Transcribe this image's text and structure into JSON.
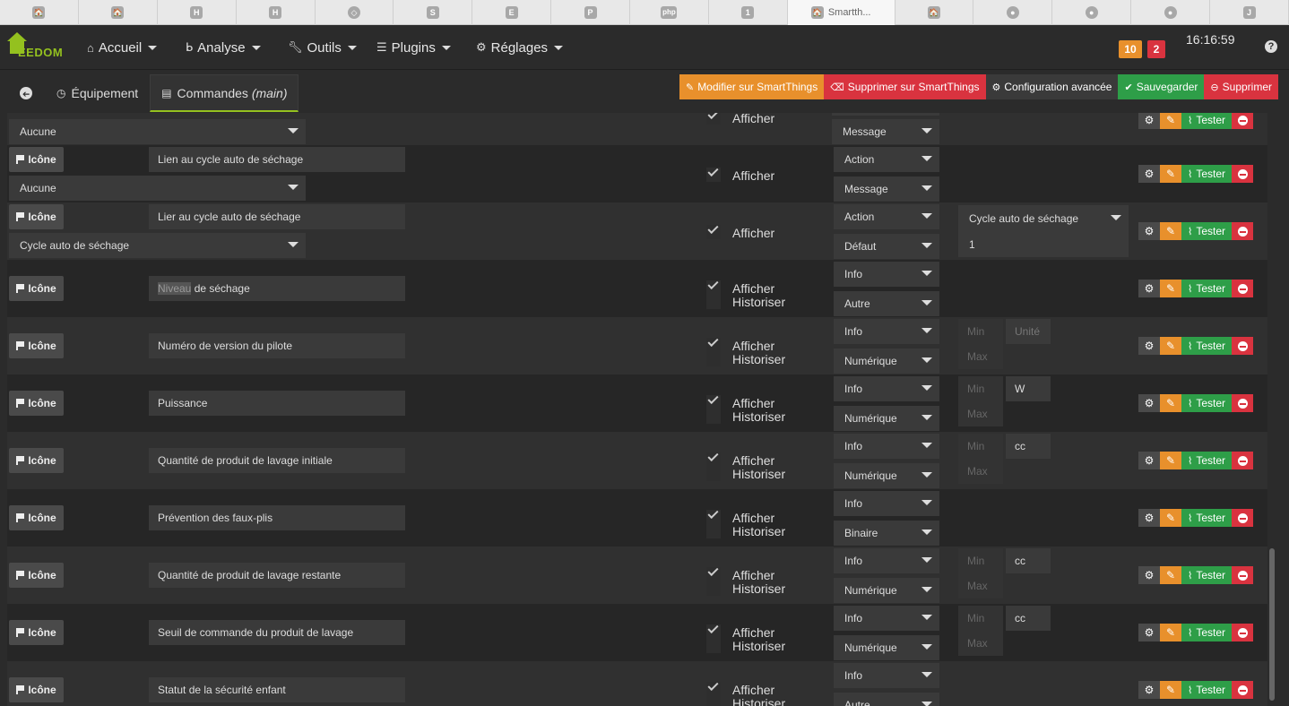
{
  "browser_tabs": [
    {
      "icon": "🏠",
      "label": ""
    },
    {
      "icon": "🏠",
      "label": ""
    },
    {
      "icon": "H",
      "label": ""
    },
    {
      "icon": "H",
      "label": ""
    },
    {
      "icon": "◇",
      "label": ""
    },
    {
      "icon": "S",
      "label": ""
    },
    {
      "icon": "E",
      "label": ""
    },
    {
      "icon": "P",
      "label": ""
    },
    {
      "icon": "php",
      "label": ""
    },
    {
      "icon": "1",
      "label": ""
    },
    {
      "icon": "🏠",
      "label": "Smartth..."
    },
    {
      "icon": "🏠",
      "label": ""
    },
    {
      "icon": "●",
      "label": ""
    },
    {
      "icon": "●",
      "label": ""
    },
    {
      "icon": "●",
      "label": ""
    },
    {
      "icon": "J",
      "label": ""
    }
  ],
  "nav": {
    "logo": "EEDOM",
    "menus": [
      {
        "label": "Accueil"
      },
      {
        "label": "Analyse"
      },
      {
        "label": "Outils"
      },
      {
        "label": "Plugins"
      },
      {
        "label": "Réglages"
      }
    ],
    "badge_warning": "10",
    "badge_danger": "2",
    "clock": "16:16:59",
    "help": "?"
  },
  "subtabs": {
    "back": "➔",
    "equipment": "Équipement",
    "commands": "Commandes",
    "commands_suffix": "(main)"
  },
  "actions": {
    "modify": "Modifier sur SmartThings",
    "delete_st": "Supprimer sur SmartThings",
    "advanced": "Configuration avancée",
    "save": "Sauvegarder",
    "delete": "Supprimer"
  },
  "commands": {
    "icon_label": "Icône",
    "afficher": "Afficher",
    "historiser": "Historiser",
    "tester": "Tester",
    "min_placeholder": "Min",
    "max_placeholder": "Max",
    "unit_placeholder": "Unité",
    "partial_row": {
      "value_select": "Aucune",
      "type": "",
      "subtype": "Message"
    },
    "rows": [
      {
        "name": "Lien au cycle auto de séchage",
        "value_select": "Aucune",
        "type": "Action",
        "subtype": "Message",
        "historiser": false
      },
      {
        "name": "Lier au cycle auto de séchage",
        "value_select": "Cycle auto de séchage",
        "type": "Action",
        "subtype": "Défaut",
        "historiser": false,
        "cycle_select": "Cycle auto de séchage",
        "cycle_value": "1"
      },
      {
        "name_highlight": "Niveau",
        "name": " de séchage",
        "type": "Info",
        "subtype": "Autre",
        "historiser": true
      },
      {
        "name": "Numéro de version du pilote",
        "type": "Info",
        "subtype": "Numérique",
        "historiser": true,
        "unit": ""
      },
      {
        "name": "Puissance",
        "type": "Info",
        "subtype": "Numérique",
        "historiser": true,
        "unit": "W"
      },
      {
        "name": "Quantité de produit de lavage initiale",
        "type": "Info",
        "subtype": "Numérique",
        "historiser": true,
        "unit": "cc"
      },
      {
        "name": "Prévention des faux-plis",
        "type": "Info",
        "subtype": "Binaire",
        "historiser": true
      },
      {
        "name": "Quantité de produit de lavage restante",
        "type": "Info",
        "subtype": "Numérique",
        "historiser": true,
        "unit": "cc"
      },
      {
        "name": "Seuil de commande du produit de lavage",
        "type": "Info",
        "subtype": "Numérique",
        "historiser": true,
        "unit": "cc"
      },
      {
        "name": "Statut de la sécurité enfant",
        "type": "Info",
        "subtype": "Autre",
        "historiser": true
      }
    ]
  },
  "colors": {
    "accent": "#94c11f",
    "warning": "#e8902c",
    "danger": "#d9333f",
    "success": "#2e9e48",
    "neutral": "#4a4a4a"
  }
}
